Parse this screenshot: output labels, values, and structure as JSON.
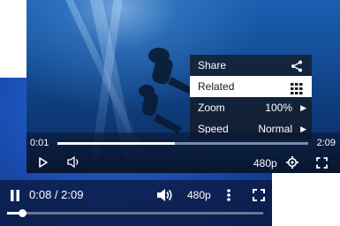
{
  "back_player": {
    "time_display": "0:08 / 2:09",
    "quality_label": "480p",
    "progress_fraction": 0.06
  },
  "front_player": {
    "time_elapsed": "0:01",
    "time_total": "2:09",
    "quality_label": "480p",
    "progress_fraction": 0.47,
    "settings_menu": {
      "items": [
        {
          "label": "Share",
          "icon": "share-icon"
        },
        {
          "label": "Related",
          "icon": "grid-icon",
          "active": true
        },
        {
          "label": "Zoom",
          "value": "100%",
          "icon": "chevron-right-icon"
        },
        {
          "label": "Speed",
          "value": "Normal",
          "icon": "chevron-right-icon"
        }
      ]
    }
  },
  "colors": {
    "accent_progress": "#ffffff",
    "track": "#7a8aa8",
    "menu_bg": "#141c28",
    "menu_active_bg": "#ffffff"
  }
}
